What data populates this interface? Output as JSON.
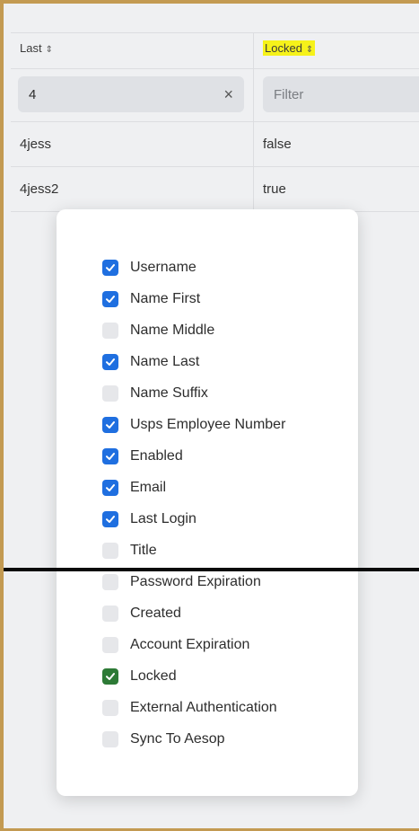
{
  "table": {
    "columns": [
      {
        "label": "Last",
        "sort_icon": "sort-icon"
      },
      {
        "label": "Locked",
        "sort_icon": "sort-icon"
      }
    ],
    "filters": {
      "last_value": "4",
      "last_clear_icon": "×",
      "locked_placeholder": "Filter"
    },
    "rows": [
      {
        "last": "4jess",
        "locked": "false"
      },
      {
        "last": "4jess2",
        "locked": "true"
      }
    ]
  },
  "column_picker": {
    "items": [
      {
        "label": "Username",
        "checked": true
      },
      {
        "label": "Name First",
        "checked": true
      },
      {
        "label": "Name Middle",
        "checked": false
      },
      {
        "label": "Name Last",
        "checked": true
      },
      {
        "label": "Name Suffix",
        "checked": false
      },
      {
        "label": "Usps Employee Number",
        "checked": true
      },
      {
        "label": "Enabled",
        "checked": true
      },
      {
        "label": "Email",
        "checked": true
      },
      {
        "label": "Last Login",
        "checked": true
      },
      {
        "label": "Title",
        "checked": false
      },
      {
        "label": "Password Expiration",
        "checked": false
      },
      {
        "label": "Created",
        "checked": false
      },
      {
        "label": "Account Expiration",
        "checked": false
      },
      {
        "label": "Locked",
        "checked": true
      },
      {
        "label": "External Authentication",
        "checked": false
      },
      {
        "label": "Sync To Aesop",
        "checked": false
      }
    ]
  },
  "colors": {
    "checkbox_checked": "#1f6fe0",
    "checkbox_checked_highlighted": "#2d7a36",
    "highlight": "#f4ef22",
    "frame_border": "#c39a52"
  }
}
